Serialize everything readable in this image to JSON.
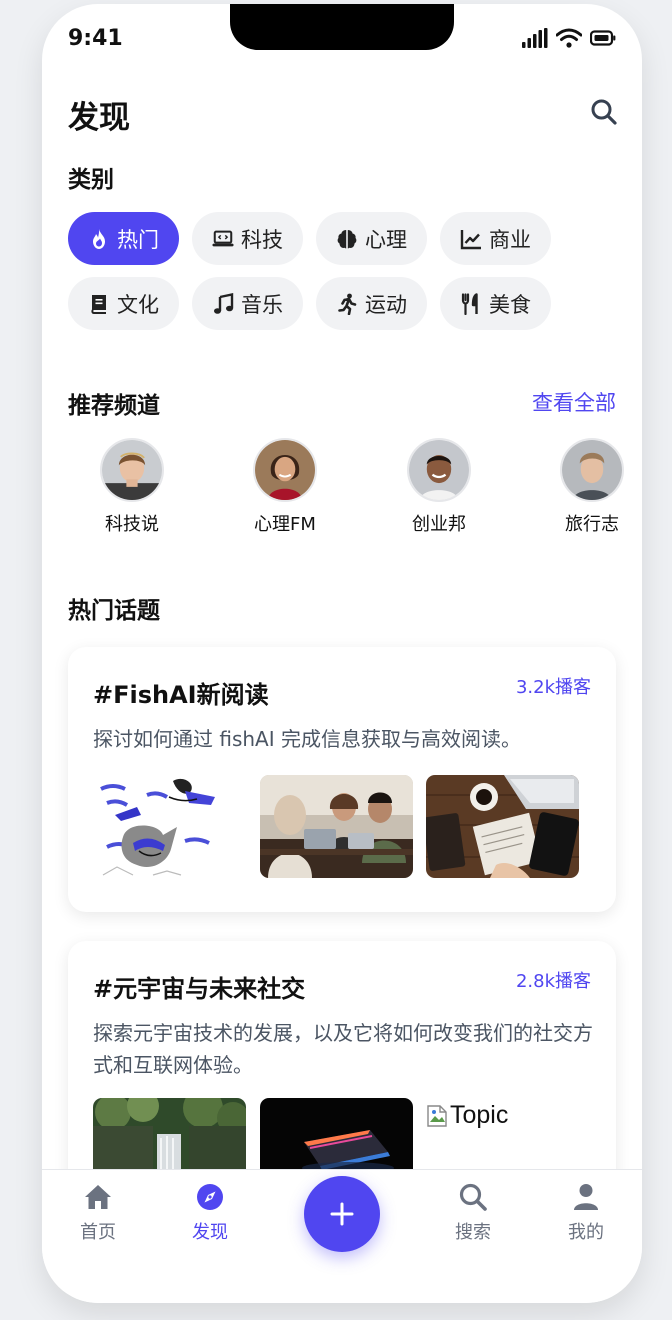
{
  "status_bar": {
    "time": "9:41"
  },
  "header": {
    "title": "发现",
    "search_icon": "search-icon"
  },
  "categories": {
    "title": "类别",
    "row1": [
      {
        "label": "热门",
        "icon": "fire-icon",
        "active": true
      },
      {
        "label": "科技",
        "icon": "laptop-code-icon",
        "active": false
      },
      {
        "label": "心理",
        "icon": "brain-icon",
        "active": false
      },
      {
        "label": "商业",
        "icon": "chart-line-icon",
        "active": false
      }
    ],
    "row2": [
      {
        "label": "文化",
        "icon": "book-icon",
        "active": false
      },
      {
        "label": "音乐",
        "icon": "music-icon",
        "active": false
      },
      {
        "label": "运动",
        "icon": "running-icon",
        "active": false
      },
      {
        "label": "美食",
        "icon": "utensils-icon",
        "active": false
      }
    ]
  },
  "channels": {
    "title": "推荐频道",
    "view_all": "查看全部",
    "items": [
      {
        "name": "科技说"
      },
      {
        "name": "心理FM"
      },
      {
        "name": "创业邦"
      },
      {
        "name": "旅行志"
      }
    ]
  },
  "topics": {
    "title": "热门话题",
    "items": [
      {
        "title": "#FishAI新阅读",
        "count": "3.2k播客",
        "description": "探讨如何通过 fishAI 完成信息获取与高效阅读。"
      },
      {
        "title": "#元宇宙与未来社交",
        "count": "2.8k播客",
        "description": "探索元宇宙技术的发展，以及它将如何改变我们的社交方式和互联网体验。",
        "broken_image_alt": "Topic"
      }
    ]
  },
  "bottom_nav": {
    "items": [
      {
        "label": "首页",
        "icon": "home-icon",
        "active": false
      },
      {
        "label": "发现",
        "icon": "compass-icon",
        "active": true
      },
      {
        "label": "搜索",
        "icon": "search-icon",
        "active": false
      },
      {
        "label": "我的",
        "icon": "user-icon",
        "active": false
      }
    ],
    "add_icon": "plus-icon"
  },
  "colors": {
    "accent": "#5046f0",
    "chip_bg": "#f1f2f4",
    "text": "#111111",
    "muted": "#4b5563"
  }
}
